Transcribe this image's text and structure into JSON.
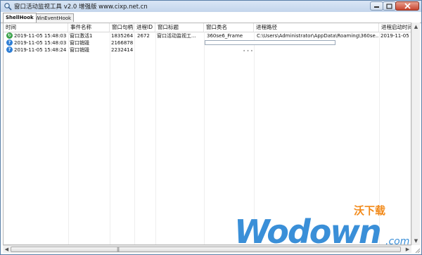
{
  "window": {
    "title": "窗口活动监视工具 v2.0 增强版 www.cixp.net.cn"
  },
  "tabs": [
    {
      "label": "ShellHook",
      "active": true
    },
    {
      "label": "WinEventHook",
      "active": false
    }
  ],
  "table": {
    "columns": [
      "时间",
      "事件名称",
      "窗口句柄",
      "进程ID",
      "窗口标题",
      "窗口类名",
      "进程路径",
      "进程启动时间"
    ],
    "rows": [
      {
        "icon": "green-refresh-icon",
        "cells": [
          "2019-11-05 15:48:03",
          "窗口激活1",
          "1835264",
          "2672",
          "窗口活动监视工...",
          "360se6_Frame",
          "C:\\Users\\Administrator\\AppData\\Roaming\\360se...",
          "2019-11-05 15:"
        ]
      },
      {
        "icon": "question-icon",
        "cells": [
          "2019-11-05 15:48:03",
          "窗口销毁",
          "2166878",
          "",
          "",
          "",
          "",
          ""
        ]
      },
      {
        "icon": "question-icon",
        "cells": [
          "2019-11-05 15:48:24",
          "窗口销毁",
          "2232414",
          "",
          "",
          "",
          "",
          ""
        ]
      }
    ]
  },
  "watermark": {
    "brand": "Wodown",
    "suffix": ".com",
    "cn": "沃下载"
  },
  "colors": {
    "titlebar": "#c3d5ec",
    "close_button": "#c7452f",
    "watermark_blue": "#3a8fd8",
    "watermark_orange": "#f28a1a"
  }
}
